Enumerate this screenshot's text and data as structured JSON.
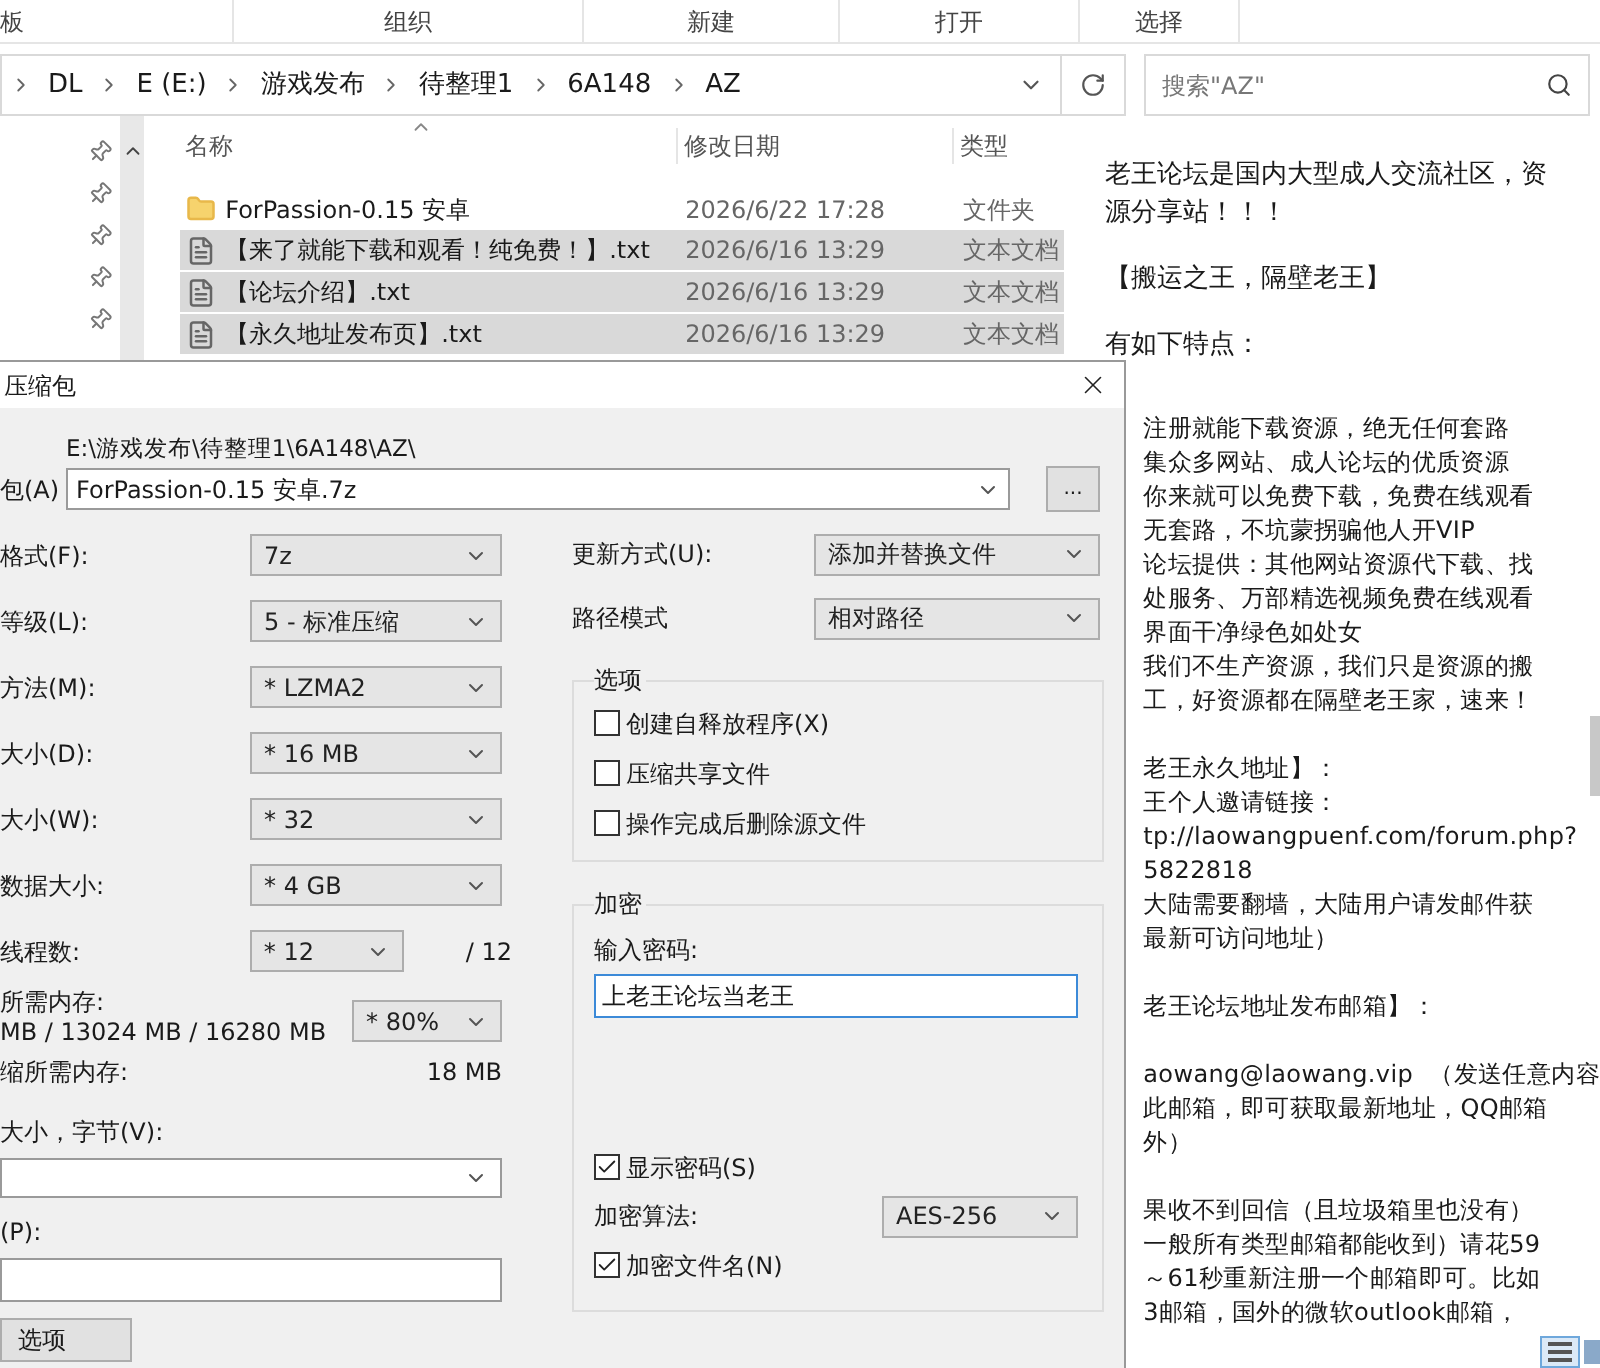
{
  "ribbon": {
    "groups": [
      "板",
      "组织",
      "新建",
      "打开",
      "选择"
    ]
  },
  "address_bar": {
    "path": [
      "DL",
      "E (E:)",
      "游戏发布",
      "待整理1",
      "6A148",
      "AZ"
    ]
  },
  "search": {
    "placeholder": "搜索\"AZ\""
  },
  "file_list": {
    "columns": [
      "名称",
      "修改日期",
      "类型"
    ],
    "rows": [
      {
        "kind": "folder",
        "name": "ForPassion-0.15 安卓",
        "date": "2026/6/22 17:28",
        "type": "文件夹",
        "selected": false
      },
      {
        "kind": "text",
        "name": "【来了就能下载和观看！纯免费！】.txt",
        "date": "2026/6/16 13:29",
        "type": "文本文档",
        "selected": true
      },
      {
        "kind": "text",
        "name": "【论坛介绍】.txt",
        "date": "2026/6/16 13:29",
        "type": "文本文档",
        "selected": true
      },
      {
        "kind": "text",
        "name": "【永久地址发布页】.txt",
        "date": "2026/6/16 13:29",
        "type": "文本文档",
        "selected": true
      }
    ]
  },
  "preview": {
    "paragraphs_top": [
      [
        "老王论坛是国内大型成人交流社区，资",
        "源分享站！！！"
      ],
      [
        "【搬运之王，隔壁老王】"
      ],
      [
        "有如下特点："
      ]
    ],
    "paragraphs_beside_dialog": [
      [
        "注册就能下载资源，绝无任何套路",
        "集众多网站、成人论坛的优质资源",
        "你来就可以免费下载，免费在线观看",
        "无套路，不坑蒙拐骗他人开VIP",
        "论坛提供：其他网站资源代下载、找",
        "处服务、万部精选视频免费在线观看",
        "界面干净绿色如处女",
        "我们不生产资源，我们只是资源的搬",
        "工，好资源都在隔壁老王家，速来！"
      ],
      [
        "老王永久地址】：",
        "王个人邀请链接：",
        "tp://laowangpuenf.com/forum.php?",
        "5822818",
        "大陆需要翻墙，大陆用户请发邮件获",
        "最新可访问地址）"
      ],
      [
        "老王论坛地址发布邮箱】："
      ],
      [
        "aowang@laowang.vip  （发送任意内容",
        "此邮箱，即可获取最新地址，QQ邮箱",
        "外）"
      ],
      [
        "果收不到回信（且垃圾箱里也没有）",
        "一般所有类型邮箱都能收到）请花59",
        "～61秒重新注册一个邮箱即可。比如",
        "3邮箱，国外的微软outlook邮箱，"
      ]
    ]
  },
  "dialog": {
    "title": "压缩包",
    "archive_label": "包(A)",
    "folder": "E:\\游戏发布\\待整理1\\6A148\\AZ\\",
    "archive_name": "ForPassion-0.15 安卓.7z",
    "browse_button": "...",
    "settings": [
      {
        "label": "格式(F):",
        "value": "7z"
      },
      {
        "label": "等级(L):",
        "value": "5 - 标准压缩"
      },
      {
        "label": "方法(M):",
        "value": "* LZMA2"
      },
      {
        "label": "大小(D):",
        "value": "* 16 MB"
      },
      {
        "label": "大小(W):",
        "value": "* 32"
      },
      {
        "label": "数据大小:",
        "value": "* 4 GB"
      }
    ],
    "threads": {
      "label": "线程数:",
      "value": "* 12",
      "max": "/ 12"
    },
    "memory": {
      "label": "所需内存:",
      "detail": "MB / 13024 MB / 16280 MB",
      "value": "* 80%"
    },
    "decompress_memory": {
      "label": "缩所需内存:",
      "value": "18 MB"
    },
    "split_label": "大小，字节(V):",
    "params_label": "(P):",
    "options_button": "选项",
    "update_mode": {
      "label": "更新方式(U):",
      "value": "添加并替换文件"
    },
    "path_mode": {
      "label": "路径模式",
      "value": "相对路径"
    },
    "options": {
      "title": "选项",
      "items": [
        {
          "label": "创建自释放程序(X)",
          "checked": false
        },
        {
          "label": "压缩共享文件",
          "checked": false
        },
        {
          "label": "操作完成后删除源文件",
          "checked": false
        }
      ]
    },
    "encryption": {
      "title": "加密",
      "password_label": "输入密码:",
      "password": "上老王论坛当老王",
      "show_password": {
        "label": "显示密码(S)",
        "checked": true
      },
      "method_label": "加密算法:",
      "method": "AES-256",
      "encrypt_names": {
        "label": "加密文件名(N)",
        "checked": true
      }
    }
  }
}
